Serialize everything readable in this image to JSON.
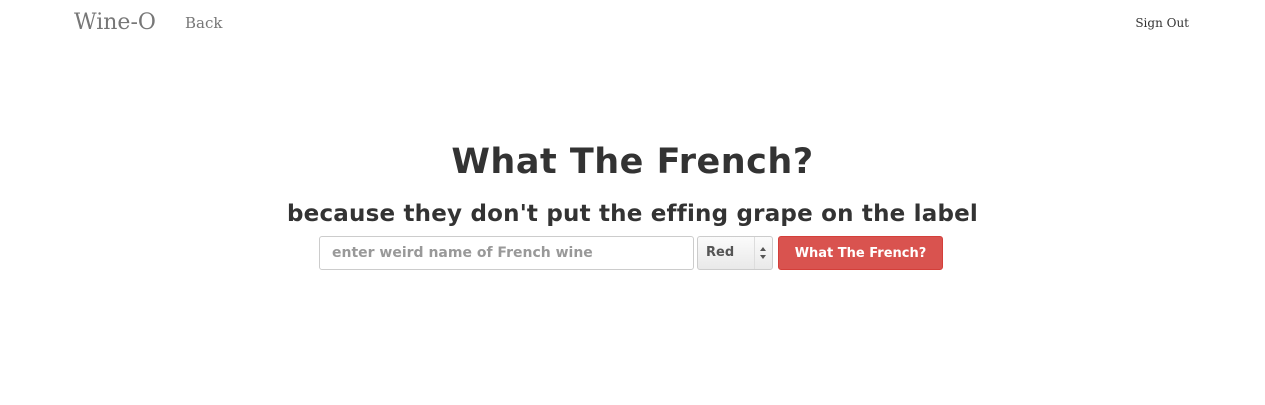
{
  "nav": {
    "brand": "Wine-O",
    "back": "Back",
    "sign_out": "Sign Out"
  },
  "hero": {
    "title": "What The French?",
    "subtitle": "because they don't put the effing grape on the label"
  },
  "search": {
    "placeholder": "enter weird name of French wine",
    "value": "",
    "wine_type_selected": "Red",
    "submit_label": "What The French?"
  },
  "colors": {
    "submit_bg": "#d9534f",
    "text": "#333333",
    "nav_text": "#777777"
  },
  "icons": {
    "select_arrows": "up-down-arrows-icon"
  }
}
